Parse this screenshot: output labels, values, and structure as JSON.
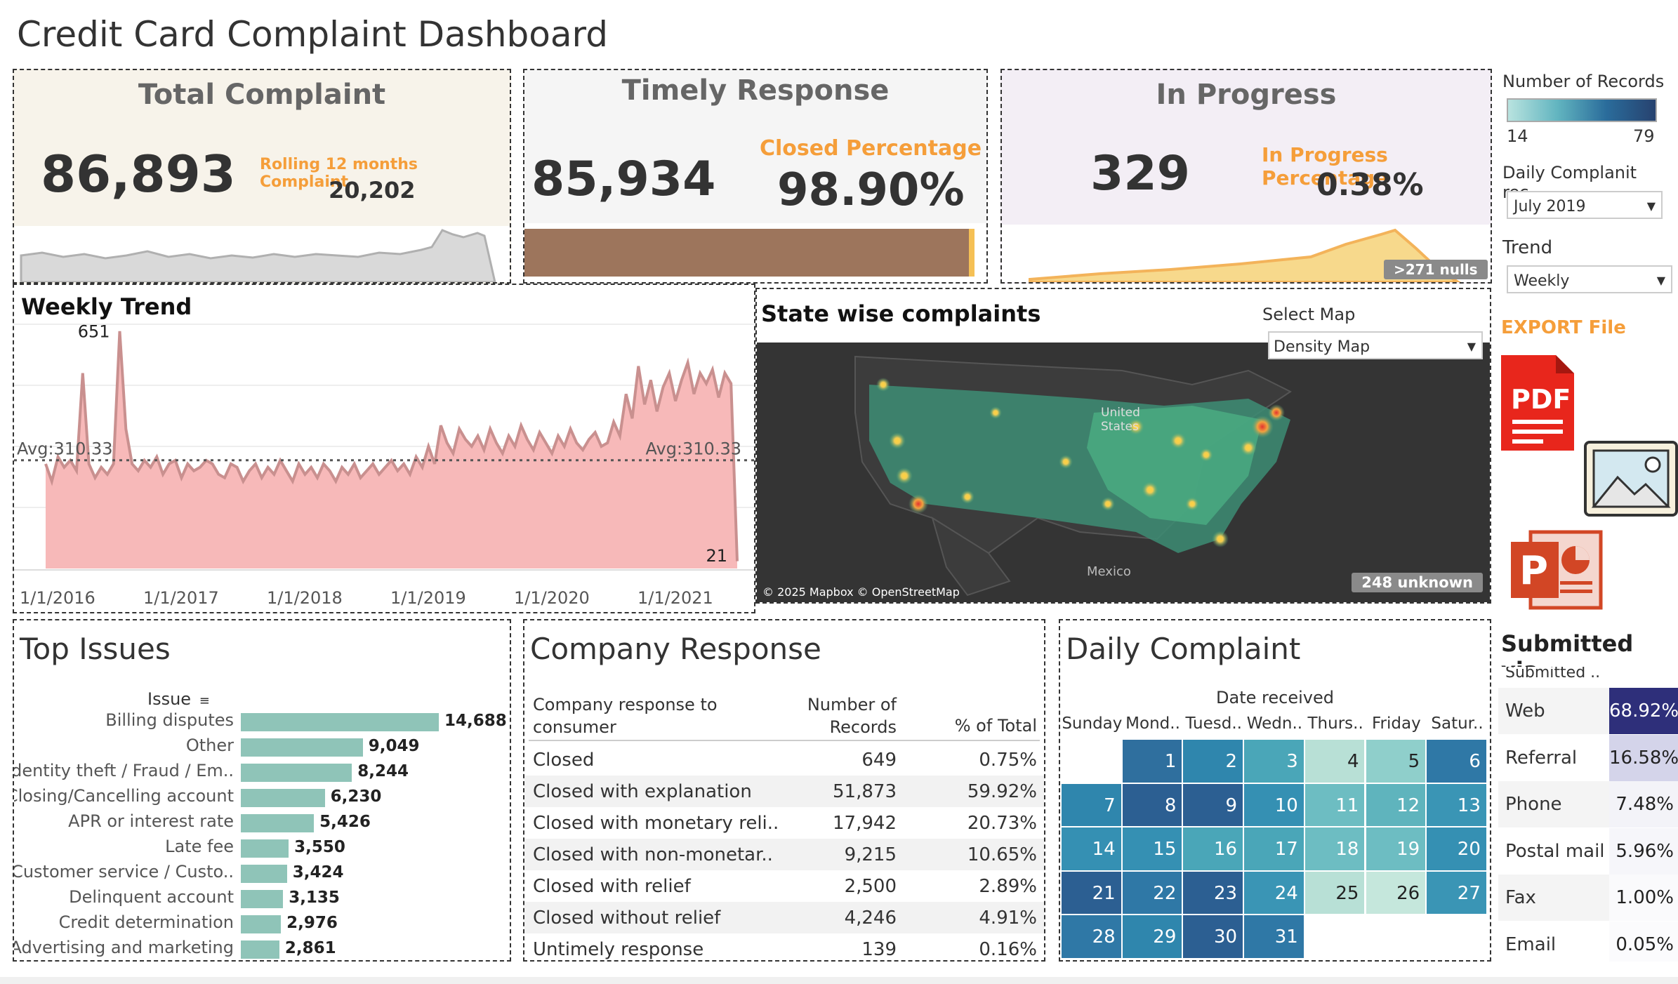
{
  "dashboard": {
    "title": "Credit Card Complaint Dashboard"
  },
  "kpi_total": {
    "title": "Total Complaint",
    "value": "86,893",
    "rolling_label": "Rolling 12 months Complaint",
    "rolling_value": "20,202"
  },
  "kpi_timely": {
    "title": "Timely Response",
    "value": "85,934",
    "pct_label": "Closed Percentage",
    "pct_value": "98.90%",
    "closed_fraction": 0.989
  },
  "kpi_progress": {
    "title": "In Progress",
    "value": "329",
    "pct_label": "In Progress Percentage",
    "pct_value": "0.38%",
    "nulls_badge": ">271 nulls"
  },
  "weekly_trend": {
    "title": "Weekly Trend",
    "max_label": "651",
    "min_label": "21",
    "avg_label": "Avg:310.33",
    "x_ticks": [
      "1/1/2016",
      "1/1/2017",
      "1/1/2018",
      "1/1/2019",
      "1/1/2020",
      "1/1/2021"
    ]
  },
  "chart_data": {
    "type": "area",
    "title": "Weekly Trend",
    "xlabel": "",
    "ylabel": "",
    "avg": 310.33,
    "max": 651,
    "min": 21,
    "x_ticks": [
      "1/1/2016",
      "1/1/2017",
      "1/1/2018",
      "1/1/2019",
      "1/1/2020",
      "1/1/2021"
    ],
    "ylim": [
      0,
      700
    ],
    "values": [
      300,
      250,
      320,
      290,
      310,
      280,
      560,
      300,
      260,
      290,
      270,
      300,
      680,
      400,
      300,
      280,
      310,
      290,
      320,
      270,
      300,
      310,
      260,
      300,
      280,
      290,
      310,
      300,
      270,
      260,
      300,
      290,
      250,
      280,
      300,
      260,
      290,
      270,
      310,
      280,
      250,
      300,
      270,
      290,
      260,
      300,
      280,
      250,
      290,
      270,
      300,
      260,
      280,
      300,
      270,
      290,
      310,
      280,
      300,
      270,
      320,
      290,
      350,
      300,
      410,
      360,
      330,
      400,
      370,
      350,
      380,
      340,
      400,
      360,
      330,
      380,
      350,
      410,
      370,
      340,
      390,
      360,
      330,
      380,
      350,
      400,
      360,
      340,
      370,
      390,
      350,
      360,
      420,
      380,
      500,
      430,
      580,
      470,
      540,
      450,
      520,
      560,
      480,
      540,
      590,
      500,
      560,
      530,
      570,
      490,
      560,
      530,
      21
    ]
  },
  "state_map": {
    "title": "State wise complaints",
    "select_label": "Select Map",
    "select_value": "Density Map",
    "place_us": "United States",
    "place_mexico": "Mexico",
    "attribution": "© 2025 Mapbox © OpenStreetMap",
    "unknown_badge": "248 unknown"
  },
  "sidebar": {
    "legend_title": "Number of Records",
    "legend_min": "14",
    "legend_max": "79",
    "daily_label": "Daily Complanit rec..",
    "daily_value": "July 2019",
    "trend_label": "Trend",
    "trend_value": "Weekly",
    "export_label": "EXPORT File",
    "submitted_title": "Submitted via",
    "submitted_header": "Submitted ..",
    "submitted_rows": [
      {
        "label": "Web",
        "value": "68.92%",
        "color": "#2e2f7a",
        "text_color": "#ffffff"
      },
      {
        "label": "Referral",
        "value": "16.58%",
        "color": "#d4d4ea",
        "text_color": "#222222"
      },
      {
        "label": "Phone",
        "value": "7.48%",
        "color": "#f3f3f8",
        "text_color": "#222222"
      },
      {
        "label": "Postal mail",
        "value": "5.96%",
        "color": "#f6f6fa",
        "text_color": "#222222"
      },
      {
        "label": "Fax",
        "value": "1.00%",
        "color": "#fafafc",
        "text_color": "#222222"
      },
      {
        "label": "Email",
        "value": "0.05%",
        "color": "#fbfbfd",
        "text_color": "#222222"
      }
    ]
  },
  "top_issues": {
    "title": "Top Issues",
    "axis_label": "Issue",
    "rows": [
      {
        "label": "Billing disputes",
        "value": "14,688",
        "n": 14688
      },
      {
        "label": "Other",
        "value": "9,049",
        "n": 9049
      },
      {
        "label": "Identity theft / Fraud / Em..",
        "value": "8,244",
        "n": 8244
      },
      {
        "label": "Closing/Cancelling account",
        "value": "6,230",
        "n": 6230
      },
      {
        "label": "APR or interest rate",
        "value": "5,426",
        "n": 5426
      },
      {
        "label": "Late fee",
        "value": "3,550",
        "n": 3550
      },
      {
        "label": "Customer service / Custo..",
        "value": "3,424",
        "n": 3424
      },
      {
        "label": "Delinquent account",
        "value": "3,135",
        "n": 3135
      },
      {
        "label": "Credit determination",
        "value": "2,976",
        "n": 2976
      },
      {
        "label": "Advertising and marketing",
        "value": "2,861",
        "n": 2861
      }
    ]
  },
  "company_response": {
    "title": "Company Response",
    "col1_line1": "Company response to",
    "col1_line2": "consumer",
    "col2_line1": "Number of",
    "col2_line2": "Records",
    "col3": "% of Total",
    "rows": [
      {
        "label": "Closed",
        "count": "649",
        "pct": "0.75%"
      },
      {
        "label": "Closed with explanation",
        "count": "51,873",
        "pct": "59.92%"
      },
      {
        "label": "Closed with monetary reli..",
        "count": "17,942",
        "pct": "20.73%"
      },
      {
        "label": "Closed with non-monetar..",
        "count": "9,215",
        "pct": "10.65%"
      },
      {
        "label": "Closed with relief",
        "count": "2,500",
        "pct": "2.89%"
      },
      {
        "label": "Closed without relief",
        "count": "4,246",
        "pct": "4.91%"
      },
      {
        "label": "Untimely response",
        "count": "139",
        "pct": "0.16%"
      }
    ]
  },
  "daily_complaint": {
    "title": "Daily Complaint",
    "header": "Date received",
    "days": [
      "Sunday",
      "Mond..",
      "Tuesd..",
      "Wedn..",
      "Thurs..",
      "Friday",
      "Satur.."
    ],
    "cells": [
      {
        "d": "1",
        "c": "#2f6f9e",
        "col": 1,
        "row": 0
      },
      {
        "d": "2",
        "c": "#2f86ad",
        "col": 2,
        "row": 0
      },
      {
        "d": "3",
        "c": "#4aa6b8",
        "col": 3,
        "row": 0
      },
      {
        "d": "4",
        "c": "#b8e0d6",
        "col": 4,
        "row": 0
      },
      {
        "d": "5",
        "c": "#8fcfcb",
        "col": 5,
        "row": 0
      },
      {
        "d": "6",
        "c": "#2f78a6",
        "col": 6,
        "row": 0
      },
      {
        "d": "7",
        "c": "#2f86ad",
        "col": 0,
        "row": 1
      },
      {
        "d": "8",
        "c": "#2c5f92",
        "col": 1,
        "row": 1
      },
      {
        "d": "9",
        "c": "#2c5f92",
        "col": 2,
        "row": 1
      },
      {
        "d": "10",
        "c": "#3590b3",
        "col": 3,
        "row": 1
      },
      {
        "d": "11",
        "c": "#6dbdc2",
        "col": 4,
        "row": 1
      },
      {
        "d": "12",
        "c": "#5fb4bd",
        "col": 5,
        "row": 1
      },
      {
        "d": "13",
        "c": "#3a95b5",
        "col": 6,
        "row": 1
      },
      {
        "d": "14",
        "c": "#3590b3",
        "col": 0,
        "row": 2
      },
      {
        "d": "15",
        "c": "#3590b3",
        "col": 1,
        "row": 2
      },
      {
        "d": "16",
        "c": "#4aa6b8",
        "col": 2,
        "row": 2
      },
      {
        "d": "17",
        "c": "#4aa6b8",
        "col": 3,
        "row": 2
      },
      {
        "d": "18",
        "c": "#6dbdc2",
        "col": 4,
        "row": 2
      },
      {
        "d": "19",
        "c": "#6dbdc2",
        "col": 5,
        "row": 2
      },
      {
        "d": "20",
        "c": "#3590b3",
        "col": 6,
        "row": 2
      },
      {
        "d": "21",
        "c": "#2c5f92",
        "col": 0,
        "row": 3
      },
      {
        "d": "22",
        "c": "#2f78a6",
        "col": 1,
        "row": 3
      },
      {
        "d": "23",
        "c": "#2c5f92",
        "col": 2,
        "row": 3
      },
      {
        "d": "24",
        "c": "#3a95b5",
        "col": 3,
        "row": 3
      },
      {
        "d": "25",
        "c": "#b8e0d6",
        "col": 4,
        "row": 3
      },
      {
        "d": "26",
        "c": "#c5e7dc",
        "col": 5,
        "row": 3
      },
      {
        "d": "27",
        "c": "#3a95b5",
        "col": 6,
        "row": 3
      },
      {
        "d": "28",
        "c": "#2f78a6",
        "col": 0,
        "row": 4
      },
      {
        "d": "29",
        "c": "#2f86ad",
        "col": 1,
        "row": 4
      },
      {
        "d": "30",
        "c": "#2c5f92",
        "col": 2,
        "row": 4
      },
      {
        "d": "31",
        "c": "#2f78a6",
        "col": 3,
        "row": 4
      }
    ]
  },
  "colors": {
    "accent_orange": "#f59e3a",
    "area_fill": "#f7b9b9",
    "area_line": "#c9908f",
    "teal_bar": "#8fc4b8",
    "progress_brown": "#9d755c"
  }
}
